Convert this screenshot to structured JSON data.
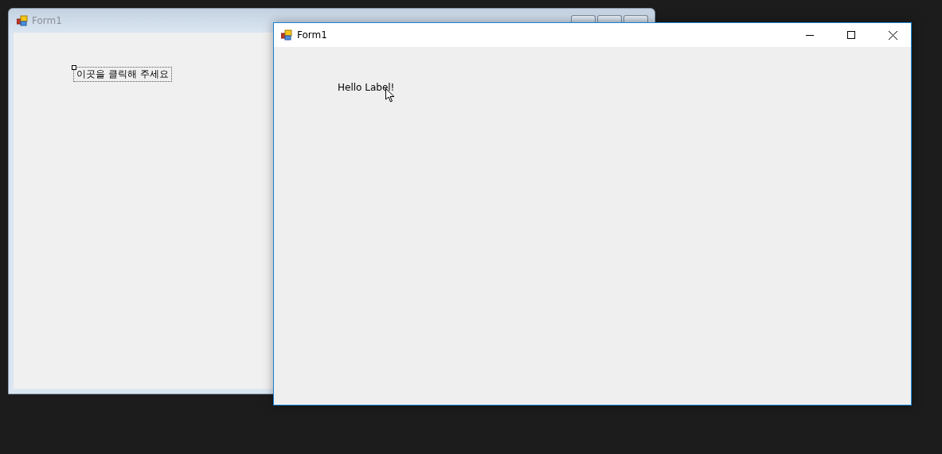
{
  "designer_window": {
    "title": "Form1",
    "label": {
      "text": "이곳을 클릭해 주세요",
      "selected": true
    }
  },
  "running_window": {
    "title": "Form1",
    "label": {
      "text": "Hello Label!"
    }
  }
}
